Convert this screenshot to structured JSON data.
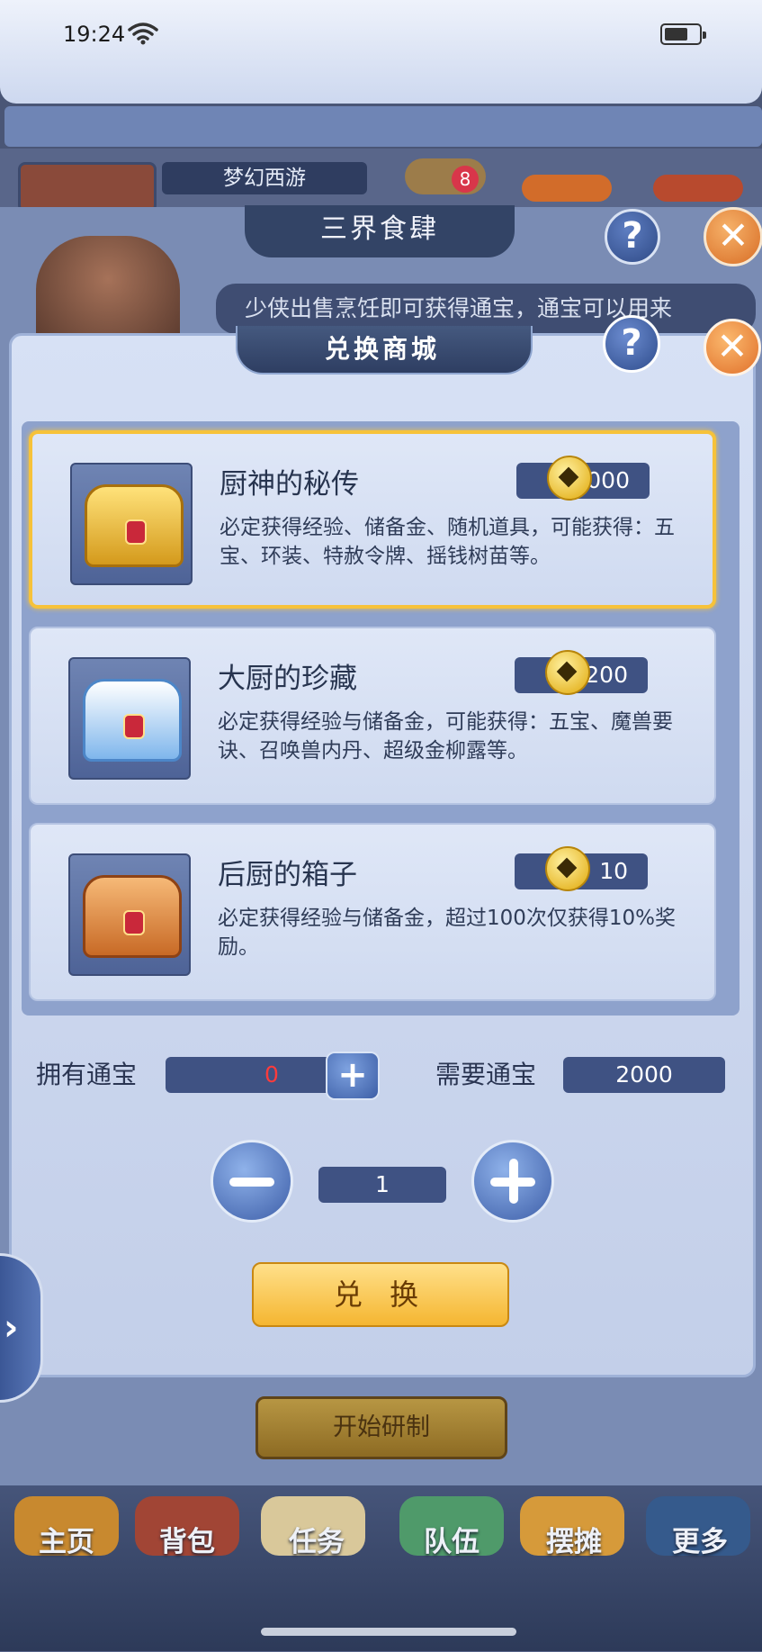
{
  "status_bar": {
    "time": "19:24",
    "battery_level": 0.7
  },
  "background": {
    "game_name": "梦幻西游",
    "top_badge": "8",
    "panel_title": "三界食肆",
    "npc_speech": "少侠出售烹饪即可获得通宝，通宝可以用来",
    "start_button": "开始研制",
    "nav": [
      "主页",
      "背包",
      "任务",
      "队伍",
      "摆摊",
      "更多"
    ]
  },
  "modal": {
    "title": "兑换商城",
    "help_glyph": "?",
    "close_glyph": "✕",
    "items": [
      {
        "name": "厨神的秘传",
        "price": "2000",
        "desc": "必定获得经验、储备金、随机道具，可能获得：五宝、环装、特赦令牌、摇钱树苗等。",
        "selected": true
      },
      {
        "name": "大厨的珍藏",
        "price": "200",
        "desc": "必定获得经验与储备金，可能获得：五宝、魔兽要诀、召唤兽内丹、超级金柳露等。",
        "selected": false
      },
      {
        "name": "后厨的箱子",
        "price": "10",
        "desc": "必定获得经验与储备金，超过100次仅获得10%奖励。",
        "selected": false
      }
    ],
    "own_label": "拥有通宝",
    "own_value": "0",
    "need_label": "需要通宝",
    "need_value": "2000",
    "quantity": "1",
    "exchange_button": "兑 换"
  },
  "colors": {
    "accent_gold": "#f6c23a",
    "panel_blue": "#3f5283",
    "own_value_red": "#ff3b3b"
  }
}
